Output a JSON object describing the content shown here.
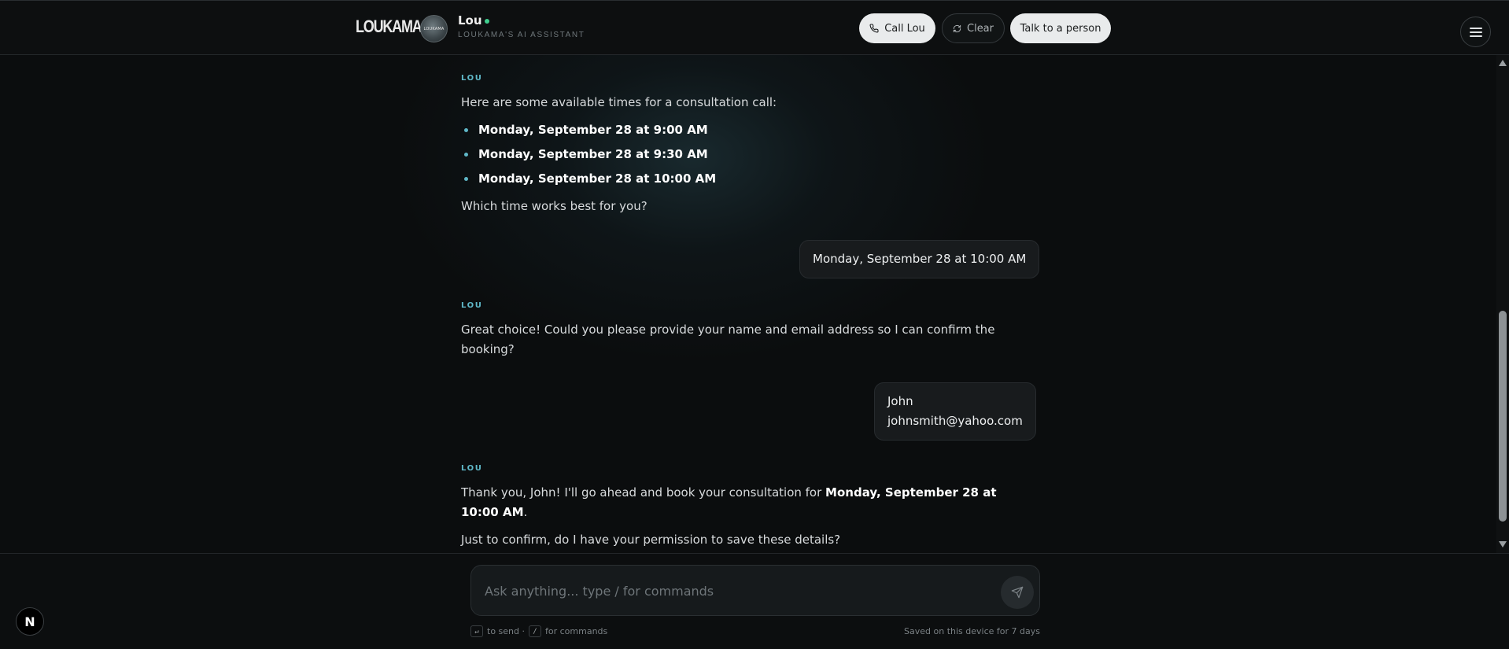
{
  "header": {
    "logo": "LOUKAMA",
    "avatar_text": "LOUKAMA",
    "assistant_name": "Lou",
    "assistant_subtitle": "LOUKAMA'S AI ASSISTANT",
    "status_color": "#3fcf8e",
    "buttons": {
      "call": "Call Lou",
      "clear": "Clear",
      "talk": "Talk to a person"
    },
    "menu_icon": "hamburger-icon"
  },
  "chat": {
    "messages": [
      {
        "sender": "LOU",
        "intro": "Here are some available times for a consultation call:",
        "options": [
          "Monday, September 28 at 9:00 AM",
          "Monday, September 28 at 9:30 AM",
          "Monday, September 28 at 10:00 AM"
        ],
        "outro": "Which time works best for you?"
      },
      {
        "sender": "user",
        "text": "Monday, September 28 at 10:00 AM"
      },
      {
        "sender": "LOU",
        "line1": "Great choice! Could you please provide your name and email address so I can confirm the",
        "line2": "booking?"
      },
      {
        "sender": "user",
        "line1": "John",
        "line2": "johnsmith@yahoo.com"
      },
      {
        "sender": "LOU",
        "line1_prefix": "Thank you, John! I'll go ahead and book your consultation for ",
        "line1_bold": "Monday, September 28 at",
        "line2_bold": "10:00 AM",
        "line2_suffix": ".",
        "line3": "Just to confirm, do I have your permission to save these details?"
      }
    ]
  },
  "composer": {
    "placeholder": "Ask anything... type / for commands",
    "send_icon": "send-icon",
    "hint_enter_key": "↵",
    "hint_send": "to send ·",
    "hint_slash_key": "/",
    "hint_commands": "for commands",
    "saved_note": "Saved on this device for 7 days"
  },
  "badge": {
    "letter": "N"
  },
  "colors": {
    "accent": "#5fb7c7",
    "background": "#0b0d0e",
    "online": "#3fcf8e"
  }
}
